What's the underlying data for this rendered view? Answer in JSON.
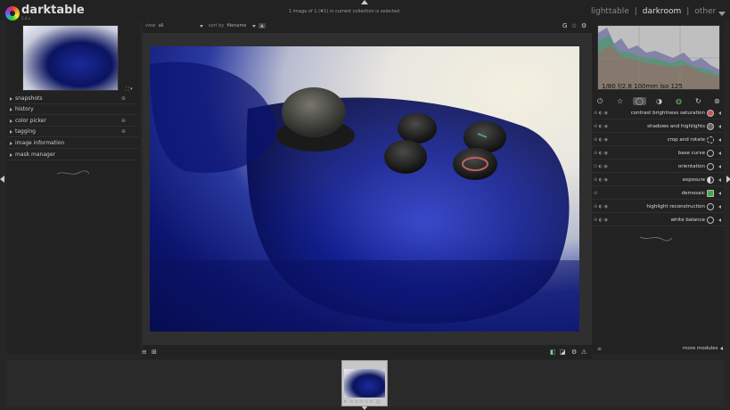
{
  "app": {
    "title": "darktable",
    "version": "1.4.x"
  },
  "header": {
    "selection_text": "1 image of 1 (#1) in current collection is selected",
    "views": [
      "lighttable",
      "darkroom",
      "other"
    ],
    "separator": "|"
  },
  "left_panel": {
    "modules": [
      {
        "label": "snapshots",
        "icon": "⊕"
      },
      {
        "label": "history",
        "icon": ""
      },
      {
        "label": "color picker",
        "icon": "⊕"
      },
      {
        "label": "tagging",
        "icon": "⊕"
      },
      {
        "label": "image information",
        "icon": ""
      },
      {
        "label": "mask manager",
        "icon": ""
      }
    ],
    "thumb_tools": "⛶ ▾"
  },
  "center_toolbar": {
    "view_label": "view",
    "view_value": "all",
    "sort_label": "sort by",
    "sort_value": "filename",
    "sort_dir": "▲",
    "icons": [
      "G",
      "☆",
      "⚙"
    ]
  },
  "histogram": {
    "info": "1/80 f/2.8 100mm iso 125"
  },
  "module_groups": [
    "⏻",
    "☆",
    "◯",
    "◑",
    "◍",
    "↻",
    "⊛"
  ],
  "modules": [
    {
      "name": "contrast brightness saturation",
      "controls": "⊘ ◐ ◉",
      "active": true
    },
    {
      "name": "shadows and highlights",
      "controls": "⊘ ◐ ◉",
      "active": true
    },
    {
      "name": "crop and rotate",
      "controls": "⊘ ◐ ◉",
      "active": true
    },
    {
      "name": "base curve",
      "controls": "⊘ ◐ ◉",
      "active": true
    },
    {
      "name": "orientation",
      "controls": "⏻ ◐ ◉",
      "active": true
    },
    {
      "name": "exposure",
      "controls": "⊘ ◐ ◉",
      "active": true
    },
    {
      "name": "demosaic",
      "controls": "⊘",
      "active": true
    },
    {
      "name": "highlight reconstruction",
      "controls": "⊘ ◐ ◉",
      "active": true
    },
    {
      "name": "white balance",
      "controls": "⊘ ◐ ◉",
      "active": true
    }
  ],
  "more_modules": {
    "label": "more modules",
    "count_icon": "≡"
  },
  "bottom_toolbar_left": [
    "≡",
    "⊞"
  ],
  "bottom_toolbar_right": [
    "◧",
    "◪",
    "⚙",
    "⚠"
  ],
  "filmstrip": {
    "stars": "☓ ☆☆☆☆☆ ○"
  },
  "colors": {
    "bg": "#262626",
    "panel": "#222222",
    "accent": "#dddddd"
  }
}
